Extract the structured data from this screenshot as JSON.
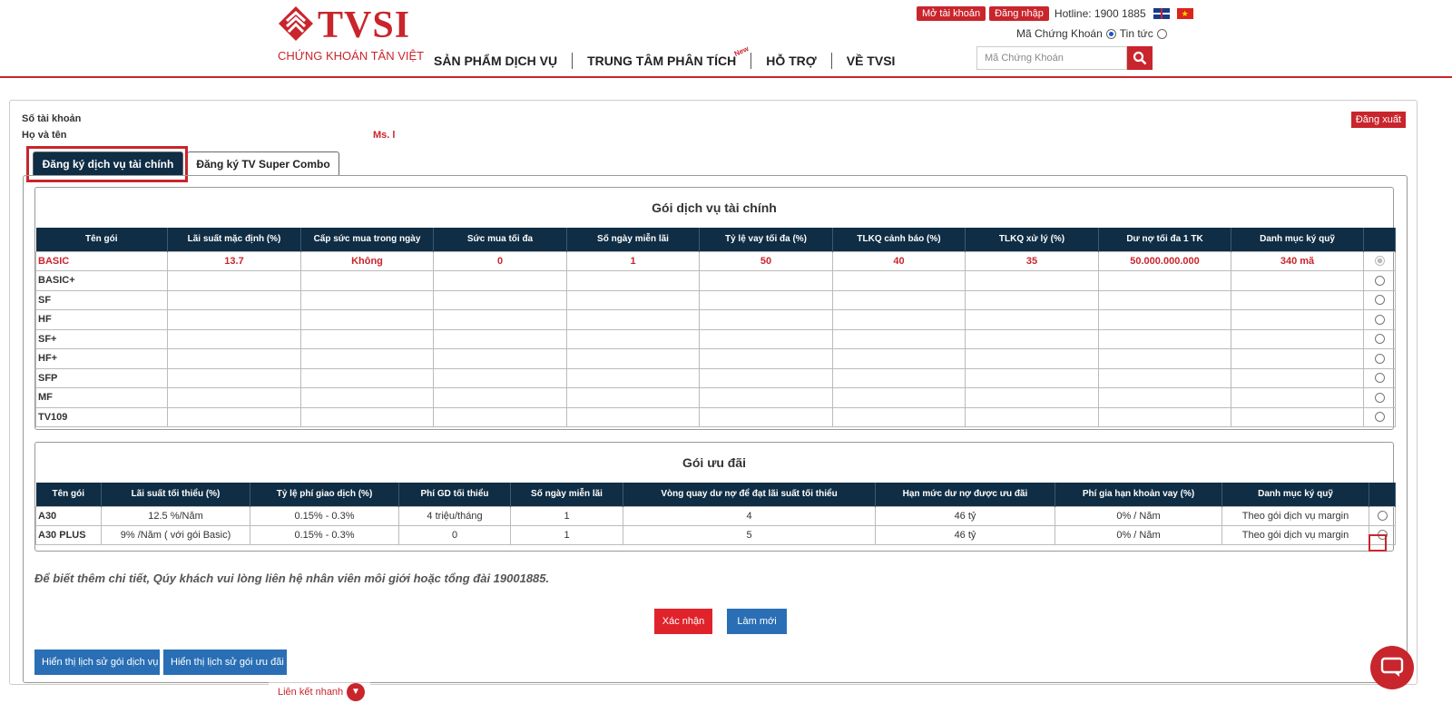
{
  "header": {
    "brand_text": "TVSI",
    "brand_sub": "CHỨNG KHOÁN TÂN VIỆT",
    "nav": [
      {
        "label": "SẢN PHẨM DỊCH VỤ"
      },
      {
        "label": "TRUNG TÂM PHÂN TÍCH",
        "badge": "New"
      },
      {
        "label": "HỖ TRỢ"
      },
      {
        "label": "VỀ TVSI"
      }
    ],
    "open_account": "Mở tài khoản",
    "login": "Đăng nhập",
    "hotline": "Hotline: 1900 1885",
    "search_mode_stock": "Mã Chứng Khoán",
    "search_mode_news": "Tin tức",
    "search_placeholder": "Mã Chứng Khoán"
  },
  "account": {
    "account_label": "Số tài khoản",
    "name_label": "Họ và tên",
    "name_value": "Ms. l",
    "logout": "Đăng xuất"
  },
  "tabs": [
    {
      "label": "Đăng ký dịch vụ tài chính",
      "active": true
    },
    {
      "label": "Đăng ký TV Super Combo",
      "active": false
    }
  ],
  "financial": {
    "title": "Gói dịch vụ tài chính",
    "columns": [
      "Tên gói",
      "Lãi suất mặc định (%)",
      "Cấp sức mua trong ngày",
      "Sức mua tối đa",
      "Số ngày miễn lãi",
      "Tỷ lệ vay tối đa (%)",
      "TLKQ cảnh báo (%)",
      "TLKQ xử lý (%)",
      "Dư nợ tối đa 1 TK",
      "Danh mục ký quỹ"
    ],
    "rows": [
      {
        "name": "BASIC",
        "cells": [
          "13.7",
          "Không",
          "0",
          "1",
          "50",
          "40",
          "35",
          "50.000.000.000",
          "340 mã"
        ],
        "selected": true
      },
      {
        "name": "BASIC+",
        "cells": [
          "",
          "",
          "",
          "",
          "",
          "",
          "",
          "",
          ""
        ]
      },
      {
        "name": "SF",
        "cells": [
          "",
          "",
          "",
          "",
          "",
          "",
          "",
          "",
          ""
        ]
      },
      {
        "name": "HF",
        "cells": [
          "",
          "",
          "",
          "",
          "",
          "",
          "",
          "",
          ""
        ]
      },
      {
        "name": "SF+",
        "cells": [
          "",
          "",
          "",
          "",
          "",
          "",
          "",
          "",
          ""
        ]
      },
      {
        "name": "HF+",
        "cells": [
          "",
          "",
          "",
          "",
          "",
          "",
          "",
          "",
          ""
        ]
      },
      {
        "name": "SFP",
        "cells": [
          "",
          "",
          "",
          "",
          "",
          "",
          "",
          "",
          ""
        ]
      },
      {
        "name": "MF",
        "cells": [
          "",
          "",
          "",
          "",
          "",
          "",
          "",
          "",
          ""
        ]
      },
      {
        "name": "TV109",
        "cells": [
          "",
          "",
          "",
          "",
          "",
          "",
          "",
          "",
          ""
        ]
      }
    ]
  },
  "promo": {
    "title": "Gói ưu đãi",
    "columns": [
      "Tên gói",
      "Lãi suất tối thiểu (%)",
      "Tỷ lệ phí giao dịch (%)",
      "Phí GD tối thiểu",
      "Số ngày miễn lãi",
      "Vòng quay dư nợ để đạt lãi suất tối thiểu",
      "Hạn mức dư nợ được ưu đãi",
      "Phí gia hạn khoản vay (%)",
      "Danh mục ký quỹ"
    ],
    "rows": [
      {
        "name": "A30",
        "cells": [
          "12.5 %/Năm",
          "0.15% - 0.3%",
          "4 triệu/tháng",
          "1",
          "4",
          "46 tỷ",
          "0% / Năm",
          "Theo gói dịch vụ margin"
        ]
      },
      {
        "name": "A30 PLUS",
        "cells": [
          "9% /Năm ( với gói Basic)",
          "0.15% - 0.3%",
          "0",
          "1",
          "5",
          "46 tỷ",
          "0% / Năm",
          "Theo gói dịch vụ margin"
        ]
      }
    ]
  },
  "note": "Để biết thêm chi tiết, Qúy khách vui lòng liên hệ nhân viên môi giới hoặc tổng đài 19001885.",
  "buttons": {
    "confirm": "Xác nhận",
    "reset": "Làm mới",
    "history_service": "Hiển thị lịch sử gói dịch vụ",
    "history_promo": "Hiển thị lịch sử gói ưu đãi"
  },
  "quicklink": "Liên kết nhanh",
  "colors": {
    "brand_red": "#c9252c",
    "header_navy": "#0f2d44",
    "button_blue": "#2a6fb5"
  }
}
